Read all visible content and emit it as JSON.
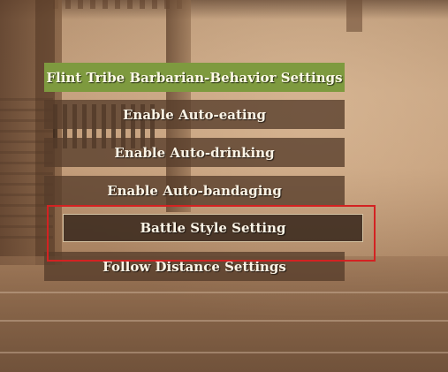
{
  "menu": {
    "header_label": "Flint Tribe Barbarian-Behavior Settings",
    "items": [
      {
        "label": "Enable Auto-eating",
        "state": "normal"
      },
      {
        "label": "Enable Auto-drinking",
        "state": "normal"
      },
      {
        "label": "Enable Auto-bandaging",
        "state": "normal"
      },
      {
        "label": "Battle Style Setting",
        "state": "selected"
      },
      {
        "label": "Follow Distance Settings",
        "state": "normal"
      }
    ]
  },
  "colors": {
    "header_bg": "#7e9a3f",
    "button_bg": "#563c2a",
    "selected_bg": "#3e2c20",
    "selected_border": "#d8c6a6",
    "highlight_frame": "#d32222",
    "text": "#fbf4e6"
  }
}
